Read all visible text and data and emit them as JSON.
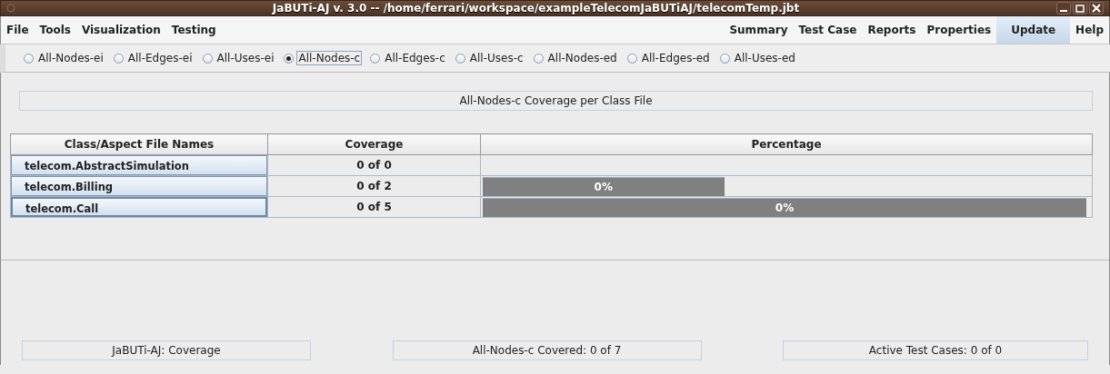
{
  "window": {
    "title": "JaBUTi-AJ v. 3.0 -- /home/ferrari/workspace/exampleTelecomJaBUTiAJ/telecomTemp.jbt"
  },
  "menu_left": [
    {
      "label": "File"
    },
    {
      "label": "Tools"
    },
    {
      "label": "Visualization"
    },
    {
      "label": "Testing"
    }
  ],
  "menu_right": [
    {
      "label": "Summary",
      "selected": false
    },
    {
      "label": "Test Case",
      "selected": false
    },
    {
      "label": "Reports",
      "selected": false
    },
    {
      "label": "Properties",
      "selected": false
    },
    {
      "label": "Update",
      "selected": true
    },
    {
      "label": "Help",
      "selected": false
    }
  ],
  "criteria": [
    {
      "label": "All-Nodes-ei",
      "selected": false
    },
    {
      "label": "All-Edges-ei",
      "selected": false
    },
    {
      "label": "All-Uses-ei",
      "selected": false
    },
    {
      "label": "All-Nodes-c",
      "selected": true
    },
    {
      "label": "All-Edges-c",
      "selected": false
    },
    {
      "label": "All-Uses-c",
      "selected": false
    },
    {
      "label": "All-Nodes-ed",
      "selected": false
    },
    {
      "label": "All-Edges-ed",
      "selected": false
    },
    {
      "label": "All-Uses-ed",
      "selected": false
    }
  ],
  "panel_title": "All-Nodes-c Coverage per Class File",
  "table": {
    "columns": [
      "Class/Aspect File Names",
      "Coverage",
      "Percentage"
    ],
    "rows": [
      {
        "name": "telecom.AbstractSimulation",
        "coverage": "0 of 0",
        "selected": false
      },
      {
        "name": "telecom.Billing",
        "coverage": "0 of 2",
        "bar": "0%",
        "level": 0.4,
        "selected": false
      },
      {
        "name": "telecom.Call",
        "coverage": "0 of 5",
        "bar": "0%",
        "level": 1,
        "selected": true
      }
    ]
  },
  "status_bar": [
    "JaBUTi-AJ: Coverage",
    "All-Nodes-c Covered: 0 of 7",
    "Active Test Cases: 0 of 0"
  ]
}
